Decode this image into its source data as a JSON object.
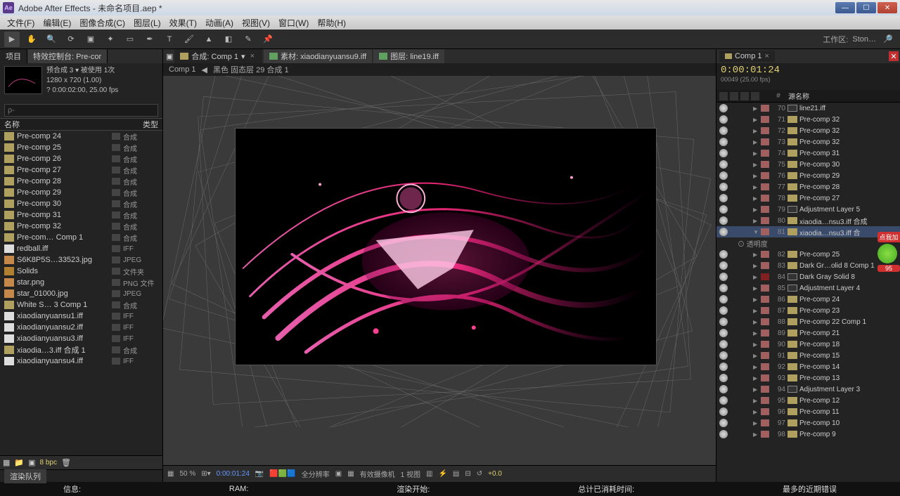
{
  "titlebar": {
    "logo": "Ae",
    "title": "Adobe After Effects - 未命名项目.aep *"
  },
  "menu": [
    "文件(F)",
    "编辑(E)",
    "图像合成(C)",
    "图层(L)",
    "效果(T)",
    "动画(A)",
    "视图(V)",
    "窗口(W)",
    "帮助(H)"
  ],
  "toolbar": {
    "workspace_label": "工作区:",
    "workspace_value": "Ston…"
  },
  "project": {
    "tab_project": "项目",
    "tab_effects": "特效控制台: Pre-cor",
    "info_name": "预合成 3 ▾ 被使用 1次",
    "info_res": "1280 x 720 (1.00)",
    "info_dur": "? 0:00:02:00, 25.00 fps",
    "search_placeholder": "ρ-",
    "col_name": "名称",
    "col_type": "类型",
    "items": [
      {
        "name": "Pre-comp 24",
        "type": "合成",
        "icon": "i-comp"
      },
      {
        "name": "Pre-comp 25",
        "type": "合成",
        "icon": "i-comp"
      },
      {
        "name": "Pre-comp 26",
        "type": "合成",
        "icon": "i-comp"
      },
      {
        "name": "Pre-comp 27",
        "type": "合成",
        "icon": "i-comp"
      },
      {
        "name": "Pre-comp 28",
        "type": "合成",
        "icon": "i-comp"
      },
      {
        "name": "Pre-comp 29",
        "type": "合成",
        "icon": "i-comp"
      },
      {
        "name": "Pre-comp 30",
        "type": "合成",
        "icon": "i-comp"
      },
      {
        "name": "Pre-comp 31",
        "type": "合成",
        "icon": "i-comp"
      },
      {
        "name": "Pre-comp 32",
        "type": "合成",
        "icon": "i-comp"
      },
      {
        "name": "Pre-com… Comp 1",
        "type": "合成",
        "icon": "i-comp"
      },
      {
        "name": "redball.iff",
        "type": "IFF",
        "icon": "i-iff"
      },
      {
        "name": "S6K8P5S…33523.jpg",
        "type": "JPEG",
        "icon": "i-jpg"
      },
      {
        "name": "Solids",
        "type": "文件夹",
        "icon": "i-folder"
      },
      {
        "name": "star.png",
        "type": "PNG 文件",
        "icon": "i-png"
      },
      {
        "name": "star_01000.jpg",
        "type": "JPEG",
        "icon": "i-jpg"
      },
      {
        "name": "White S… 3 Comp 1",
        "type": "合成",
        "icon": "i-comp"
      },
      {
        "name": "xiaodianyuansu1.iff",
        "type": "IFF",
        "icon": "i-iff"
      },
      {
        "name": "xiaodianyuansu2.iff",
        "type": "IFF",
        "icon": "i-iff"
      },
      {
        "name": "xiaodianyuansu3.iff",
        "type": "IFF",
        "icon": "i-iff"
      },
      {
        "name": "xiaodia…3.iff 合成 1",
        "type": "合成",
        "icon": "i-comp"
      },
      {
        "name": "xiaodianyuansu4.iff",
        "type": "IFF",
        "icon": "i-iff"
      }
    ],
    "bpc": "8 bpc"
  },
  "viewer": {
    "tab1": "合成: Comp 1",
    "tab2": "素材: xiaodianyuansu9.iff",
    "tab3": "图层: line19.iff",
    "crumb1": "Comp 1",
    "crumb2": "黑色 固态层 29 合成 1",
    "zoom": "50 %",
    "timecode": "0:00:01:24",
    "res": "全分辨率",
    "camera": "有效摄像机",
    "views": "1 视图",
    "exposure": "+0.0"
  },
  "timeline": {
    "tab": "Comp 1",
    "time": "0:00:01:24",
    "fps": "00049 (25.00 fps)",
    "col_num": "#",
    "col_src": "源名称",
    "sub_opacity": "⊙ 透明度",
    "layers": [
      {
        "n": 70,
        "name": "line21.iff",
        "t": "solid"
      },
      {
        "n": 71,
        "name": "Pre-comp 32",
        "t": "comp"
      },
      {
        "n": 72,
        "name": "Pre-comp 32",
        "t": "comp"
      },
      {
        "n": 73,
        "name": "Pre-comp 32",
        "t": "comp"
      },
      {
        "n": 74,
        "name": "Pre-comp 31",
        "t": "comp"
      },
      {
        "n": 75,
        "name": "Pre-comp 30",
        "t": "comp"
      },
      {
        "n": 76,
        "name": "Pre-comp 29",
        "t": "comp"
      },
      {
        "n": 77,
        "name": "Pre-comp 28",
        "t": "comp"
      },
      {
        "n": 78,
        "name": "Pre-comp 27",
        "t": "comp"
      },
      {
        "n": 79,
        "name": "Adjustment Layer 5",
        "t": "solid"
      },
      {
        "n": 80,
        "name": "xiaodia…nsu3.iff 合成",
        "t": "comp"
      },
      {
        "n": 81,
        "name": "xiaodia…nsu3.iff 合",
        "t": "comp",
        "sel": true,
        "open": true
      },
      {
        "n": 82,
        "name": "Pre-comp 25",
        "t": "comp"
      },
      {
        "n": 83,
        "name": "Dark Gr…olid 8 Comp 1",
        "t": "comp"
      },
      {
        "n": 84,
        "name": "Dark Gray Solid 8",
        "t": "solid",
        "dark": true
      },
      {
        "n": 85,
        "name": "Adjustment Layer 4",
        "t": "solid"
      },
      {
        "n": 86,
        "name": "Pre-comp 24",
        "t": "comp"
      },
      {
        "n": 87,
        "name": "Pre-comp 23",
        "t": "comp"
      },
      {
        "n": 88,
        "name": "Pre-comp 22 Comp 1",
        "t": "comp"
      },
      {
        "n": 89,
        "name": "Pre-comp 21",
        "t": "comp"
      },
      {
        "n": 90,
        "name": "Pre-comp 18",
        "t": "comp"
      },
      {
        "n": 91,
        "name": "Pre-comp 15",
        "t": "comp"
      },
      {
        "n": 92,
        "name": "Pre-comp 14",
        "t": "comp"
      },
      {
        "n": 93,
        "name": "Pre-comp 13",
        "t": "comp"
      },
      {
        "n": 94,
        "name": "Adjustment Layer 3",
        "t": "solid"
      },
      {
        "n": 95,
        "name": "Pre-comp 12",
        "t": "comp"
      },
      {
        "n": 96,
        "name": "Pre-comp 11",
        "t": "comp"
      },
      {
        "n": 97,
        "name": "Pre-comp 10",
        "t": "comp"
      },
      {
        "n": 98,
        "name": "Pre-comp 9",
        "t": "comp"
      }
    ]
  },
  "badge": {
    "top": "点我加",
    "num": "95"
  },
  "render": {
    "tab": "渲染队列"
  },
  "status": {
    "info": "信息:",
    "ram": "RAM:",
    "start": "渲染开始:",
    "elapsed": "总计已消耗时间:",
    "recent": "最多的近期错误"
  }
}
